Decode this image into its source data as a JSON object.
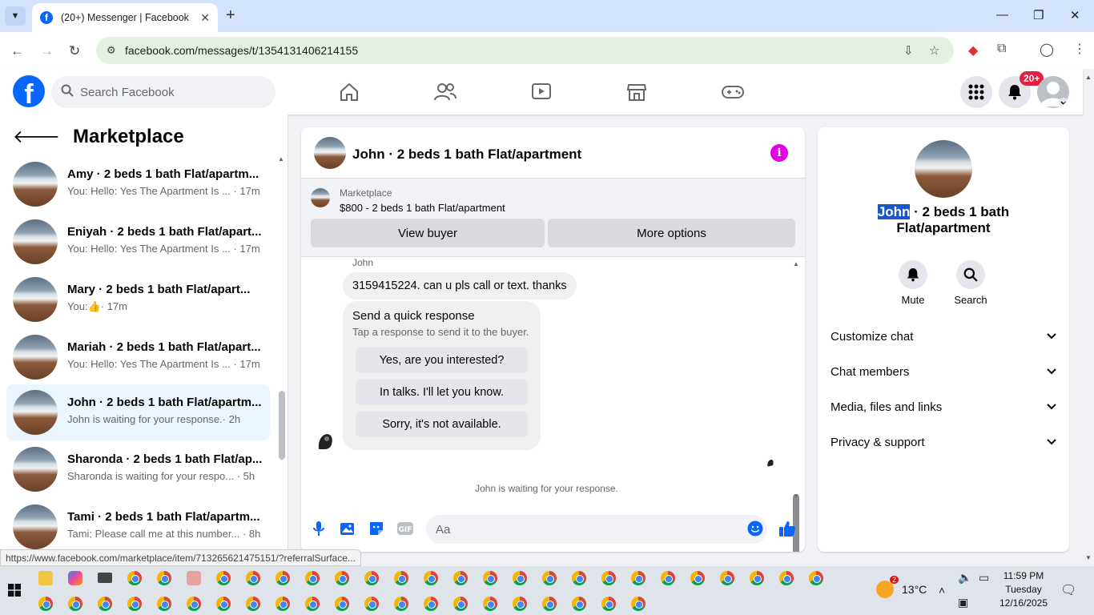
{
  "browser": {
    "tab_title": "(20+) Messenger | Facebook",
    "url": "facebook.com/messages/t/1354131406214155",
    "status_url": "https://www.facebook.com/marketplace/item/713265621475151/?referralSurface..."
  },
  "fb": {
    "search_placeholder": "Search Facebook",
    "notif_badge": "20+"
  },
  "left": {
    "title": "Marketplace",
    "threads": [
      {
        "title": "Amy · 2 beds 1 bath Flat/apartm...",
        "preview": "You: Hello: Yes The Apartment Is ...",
        "time": "· 17m"
      },
      {
        "title": "Eniyah · 2 beds 1 bath Flat/apart...",
        "preview": "You: Hello: Yes The Apartment Is ...",
        "time": "· 17m"
      },
      {
        "title": "Mary · 2 beds 1 bath Flat/apart...",
        "preview": "You:",
        "time": "· 17m"
      },
      {
        "title": "Mariah · 2 beds 1 bath Flat/apart...",
        "preview": "You: Hello: Yes The Apartment Is ...",
        "time": "· 17m"
      },
      {
        "title": "John · 2 beds 1 bath Flat/apartm...",
        "preview": "John is waiting for your response.",
        "time": "· 2h"
      },
      {
        "title": "Sharonda · 2 beds 1 bath Flat/ap...",
        "preview": "Sharonda is waiting for your respo...",
        "time": "· 5h"
      },
      {
        "title": "Tami · 2 beds 1 bath Flat/apartm...",
        "preview": "Tami: Please call me at this number...",
        "time": "· 8h"
      }
    ]
  },
  "chat": {
    "title": "John · 2 beds 1 bath Flat/apartment",
    "listing_source": "Marketplace",
    "listing": "$800 - 2 beds 1 bath Flat/apartment",
    "view_buyer": "View buyer",
    "more_options": "More options",
    "sender": "John",
    "message": "3159415224. can u pls call or text. thanks",
    "quick_title": "Send a quick response",
    "quick_sub": "Tap a response to send it to the buyer.",
    "quick_1": "Yes, are you interested?",
    "quick_2": "In talks. I'll let you know.",
    "quick_3": "Sorry, it's not available.",
    "waiting": "John is waiting for your response.",
    "input_placeholder": "Aa"
  },
  "info": {
    "name_highlight": "John",
    "name_rest": " · 2 beds 1 bath Flat/apartment",
    "mute": "Mute",
    "search": "Search",
    "sections": [
      "Customize chat",
      "Chat members",
      "Media, files and links",
      "Privacy & support"
    ]
  },
  "taskbar": {
    "temp": "13°C",
    "weather_badge": "2",
    "time": "11:59 PM",
    "day": "Tuesday",
    "date": "12/16/2025"
  },
  "colors": {
    "fb_blue": "#0866ff",
    "info_magenta": "#e400e4",
    "badge_red": "#e41e3f",
    "active_thread": "#ebf5ff"
  }
}
